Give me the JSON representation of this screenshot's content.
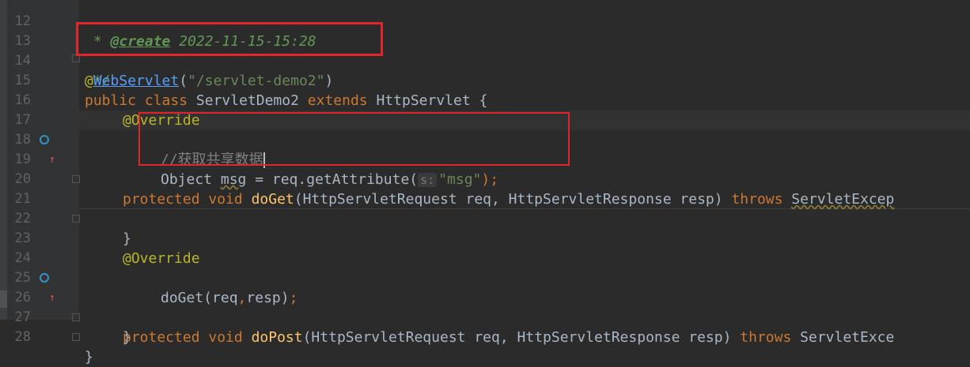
{
  "editor": {
    "lines": [
      {
        "num": "12",
        "doc_prefix": " * ",
        "doc_tag": "@create",
        "doc_rest": " 2022-11-15-15:28"
      },
      {
        "num": "13",
        "doc_close": " */"
      },
      {
        "num": "14",
        "at": "@",
        "annotation": "WebServlet",
        "paren_open": "(",
        "arg": "\"/servlet-demo2\"",
        "paren_close": ")"
      },
      {
        "num": "15",
        "kw1": "public class ",
        "name": "ServletDemo2 ",
        "kw2": "extends ",
        "parent": "HttpServlet {"
      },
      {
        "num": "16",
        "annotation": "@Override"
      },
      {
        "num": "17",
        "kw": "protected void ",
        "method": "doGet",
        "params": "(HttpServletRequest req, HttpServletResponse resp) ",
        "throws": "throws ",
        "exception": "ServletExcep"
      },
      {
        "num": "18",
        "comment": "//获取共享数据"
      },
      {
        "num": "19",
        "type": "Object ",
        "var": "msg",
        "assign": " = req.getAttribute(",
        "hint": "s:",
        "arg": "\"msg\"",
        "end": ");"
      },
      {
        "num": "20"
      },
      {
        "num": "21",
        "brace": "}"
      },
      {
        "num": "22"
      },
      {
        "num": "23",
        "annotation": "@Override"
      },
      {
        "num": "24",
        "kw": "protected void ",
        "method": "doPost",
        "params": "(HttpServletRequest req, HttpServletResponse resp) ",
        "throws": "throws ",
        "exception": "ServletExce"
      },
      {
        "num": "25",
        "call": "doGet(req",
        "comma": ",",
        "call_rest": "resp)",
        "semi": ";"
      },
      {
        "num": "26",
        "brace": "}"
      },
      {
        "num": "27",
        "brace": "}"
      },
      {
        "num": "28"
      }
    ]
  },
  "colors": {
    "background": "#2b2b2b",
    "keyword": "#cc7832",
    "annotation": "#bbb529",
    "string": "#6a8759",
    "highlight_box": "#e0262b"
  },
  "icons": {
    "override": "implements-method-icon",
    "up_arrow": "overrides-up-arrow-icon"
  }
}
